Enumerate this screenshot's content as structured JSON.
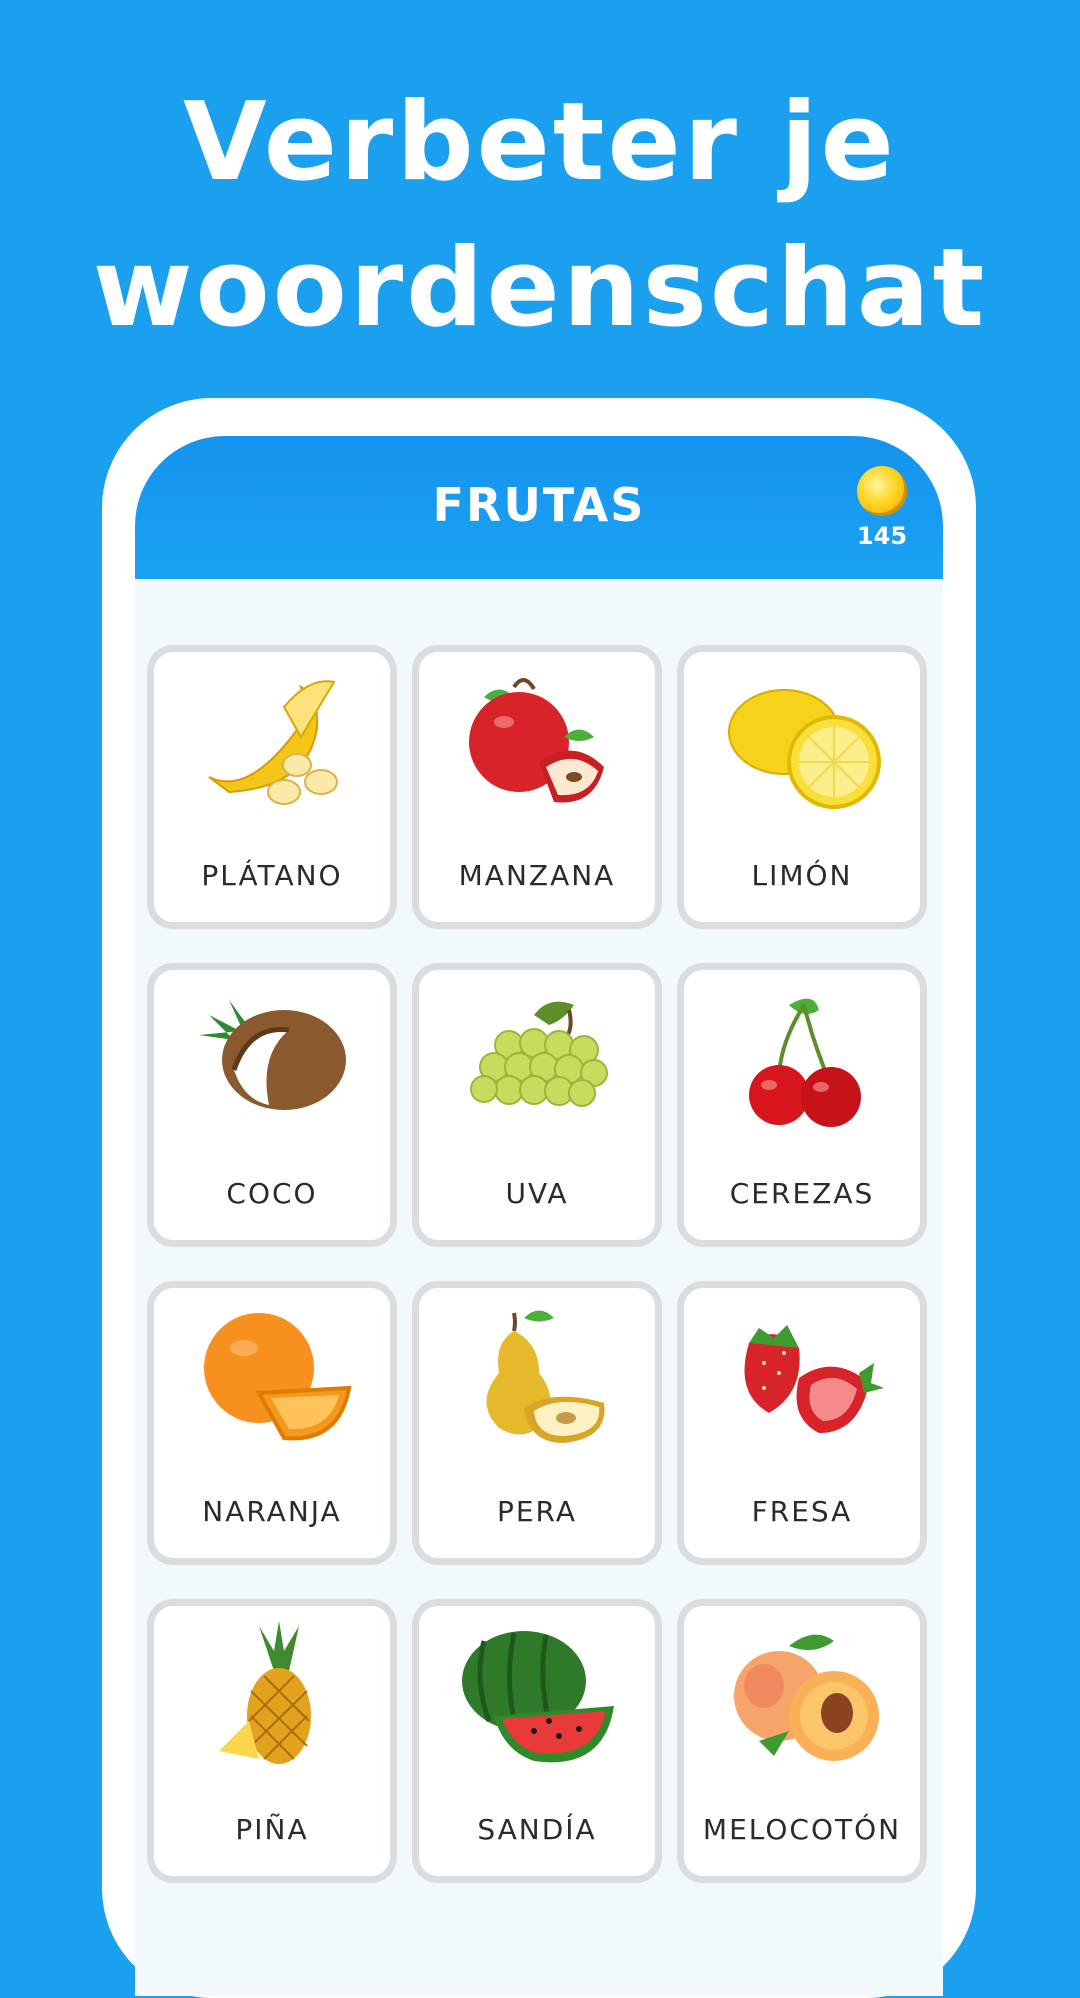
{
  "headline": {
    "line1": "Verbeter je",
    "line2": "woordenschat"
  },
  "app": {
    "title": "FRUTAS",
    "coins": "145",
    "coin_icon": "coin-icon"
  },
  "colors": {
    "background": "#1aa0ee",
    "appbar": "#1493ee",
    "card_border": "#dcdcdc"
  },
  "cards": [
    {
      "label": "PLÁTANO",
      "icon": "banana-icon"
    },
    {
      "label": "MANZANA",
      "icon": "apple-icon"
    },
    {
      "label": "LIMÓN",
      "icon": "lemon-icon"
    },
    {
      "label": "COCO",
      "icon": "coconut-icon"
    },
    {
      "label": "UVA",
      "icon": "grapes-icon"
    },
    {
      "label": "CEREZAS",
      "icon": "cherries-icon"
    },
    {
      "label": "NARANJA",
      "icon": "orange-icon"
    },
    {
      "label": "PERA",
      "icon": "pear-icon"
    },
    {
      "label": "FRESA",
      "icon": "strawberry-icon"
    },
    {
      "label": "PIÑA",
      "icon": "pineapple-icon"
    },
    {
      "label": "SANDÍA",
      "icon": "watermelon-icon"
    },
    {
      "label": "MELOCOTÓN",
      "icon": "peach-icon"
    }
  ]
}
